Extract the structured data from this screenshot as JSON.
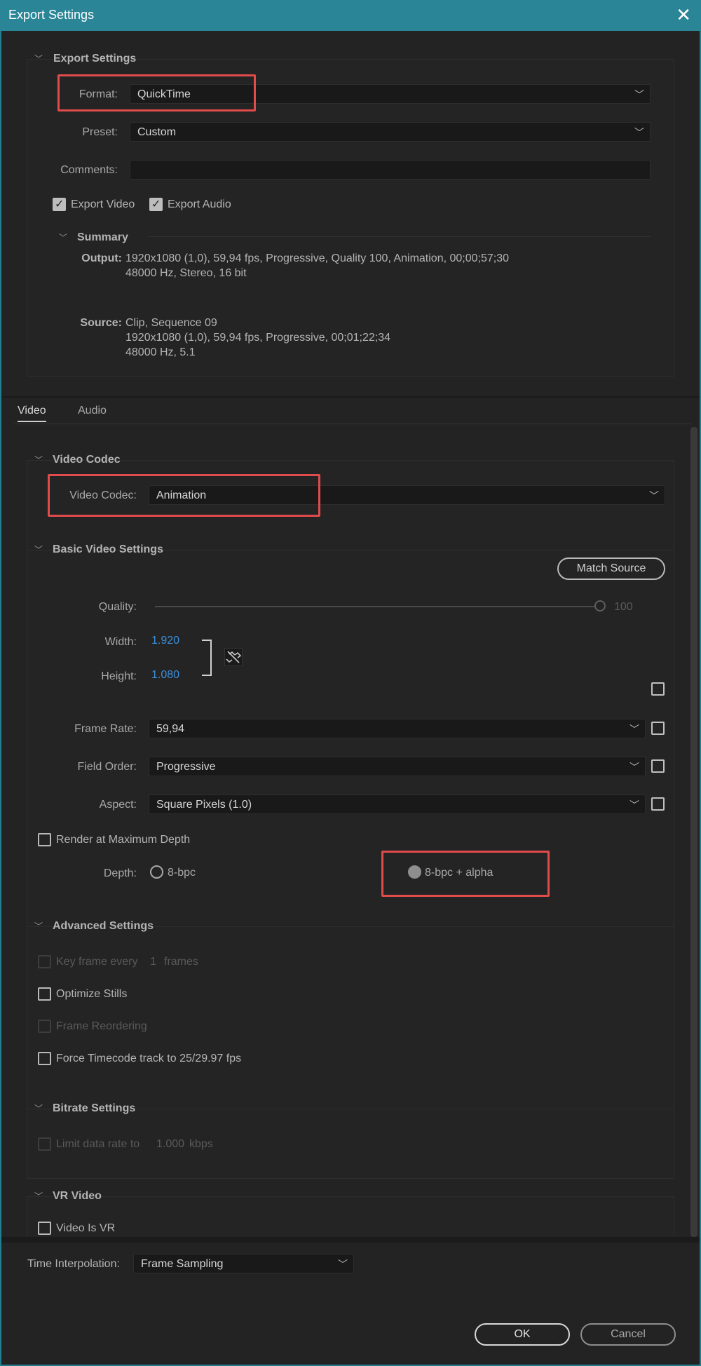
{
  "window": {
    "title": "Export Settings"
  },
  "export_settings": {
    "heading": "Export Settings",
    "format_label": "Format:",
    "format_value": "QuickTime",
    "preset_label": "Preset:",
    "preset_value": "Custom",
    "comments_label": "Comments:",
    "comments_value": "",
    "export_video_label": "Export Video",
    "export_audio_label": "Export Audio",
    "summary_heading": "Summary",
    "output_label": "Output:",
    "output_line1": "1920x1080 (1,0), 59,94 fps, Progressive, Quality 100, Animation, 00;00;57;30",
    "output_line2": "48000 Hz, Stereo, 16 bit",
    "source_label": "Source:",
    "source_line1": "Clip, Sequence 09",
    "source_line2": "1920x1080 (1,0), 59,94 fps, Progressive, 00;01;22;34",
    "source_line3": "48000 Hz, 5.1"
  },
  "tabs": [
    {
      "label": "Video",
      "active": true
    },
    {
      "label": "Audio",
      "active": false
    }
  ],
  "video_codec": {
    "heading": "Video Codec",
    "codec_label": "Video Codec:",
    "codec_value": "Animation"
  },
  "basic_video": {
    "heading": "Basic Video Settings",
    "match_source": "Match Source",
    "quality_label": "Quality:",
    "quality_value": "100",
    "width_label": "Width:",
    "width_value": "1.920",
    "height_label": "Height:",
    "height_value": "1.080",
    "frame_rate_label": "Frame Rate:",
    "frame_rate_value": "59,94",
    "field_order_label": "Field Order:",
    "field_order_value": "Progressive",
    "aspect_label": "Aspect:",
    "aspect_value": "Square Pixels (1.0)",
    "render_max_depth": "Render at Maximum Depth",
    "depth_label": "Depth:",
    "depth_opt1": "8-bpc",
    "depth_opt2": "8-bpc + alpha"
  },
  "advanced": {
    "heading": "Advanced Settings",
    "keyframe_label": "Key frame every",
    "keyframe_value": "1",
    "keyframe_unit": "frames",
    "optimize_stills": "Optimize Stills",
    "frame_reordering": "Frame Reordering",
    "force_timecode": "Force Timecode track to 25/29.97 fps"
  },
  "bitrate": {
    "heading": "Bitrate Settings",
    "limit_label": "Limit data rate to",
    "limit_value": "1.000",
    "limit_unit": "kbps"
  },
  "vr": {
    "heading": "VR Video",
    "video_is_vr": "Video Is VR"
  },
  "footer": {
    "time_interp_label": "Time Interpolation:",
    "time_interp_value": "Frame Sampling",
    "ok": "OK",
    "cancel": "Cancel"
  }
}
